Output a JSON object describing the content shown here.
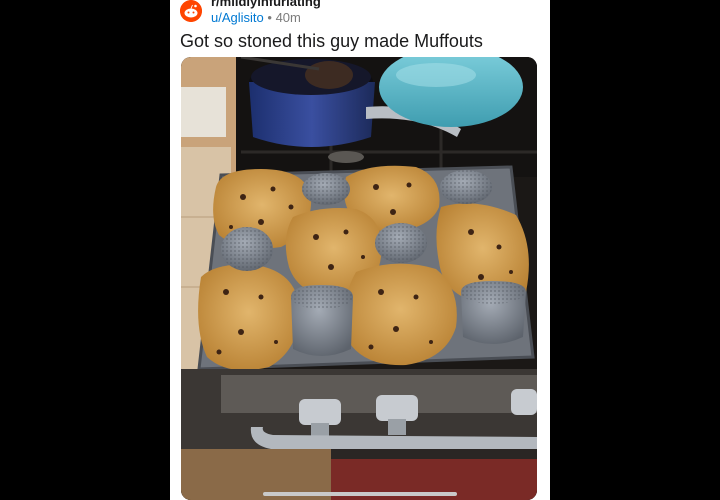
{
  "post": {
    "subreddit": "r/mildlyinfuriating",
    "author": "u/Aglisito",
    "separator": "•",
    "age": "40m",
    "title": "Got so stoned this guy made Muffouts"
  },
  "colors": {
    "accent": "#ff4500",
    "username": "#0079d3",
    "muted": "#7c7c7c",
    "text": "#1a1a1b"
  },
  "icons": {
    "avatar": "snoo-avatar-icon",
    "gesture_bar": "home-indicator"
  }
}
